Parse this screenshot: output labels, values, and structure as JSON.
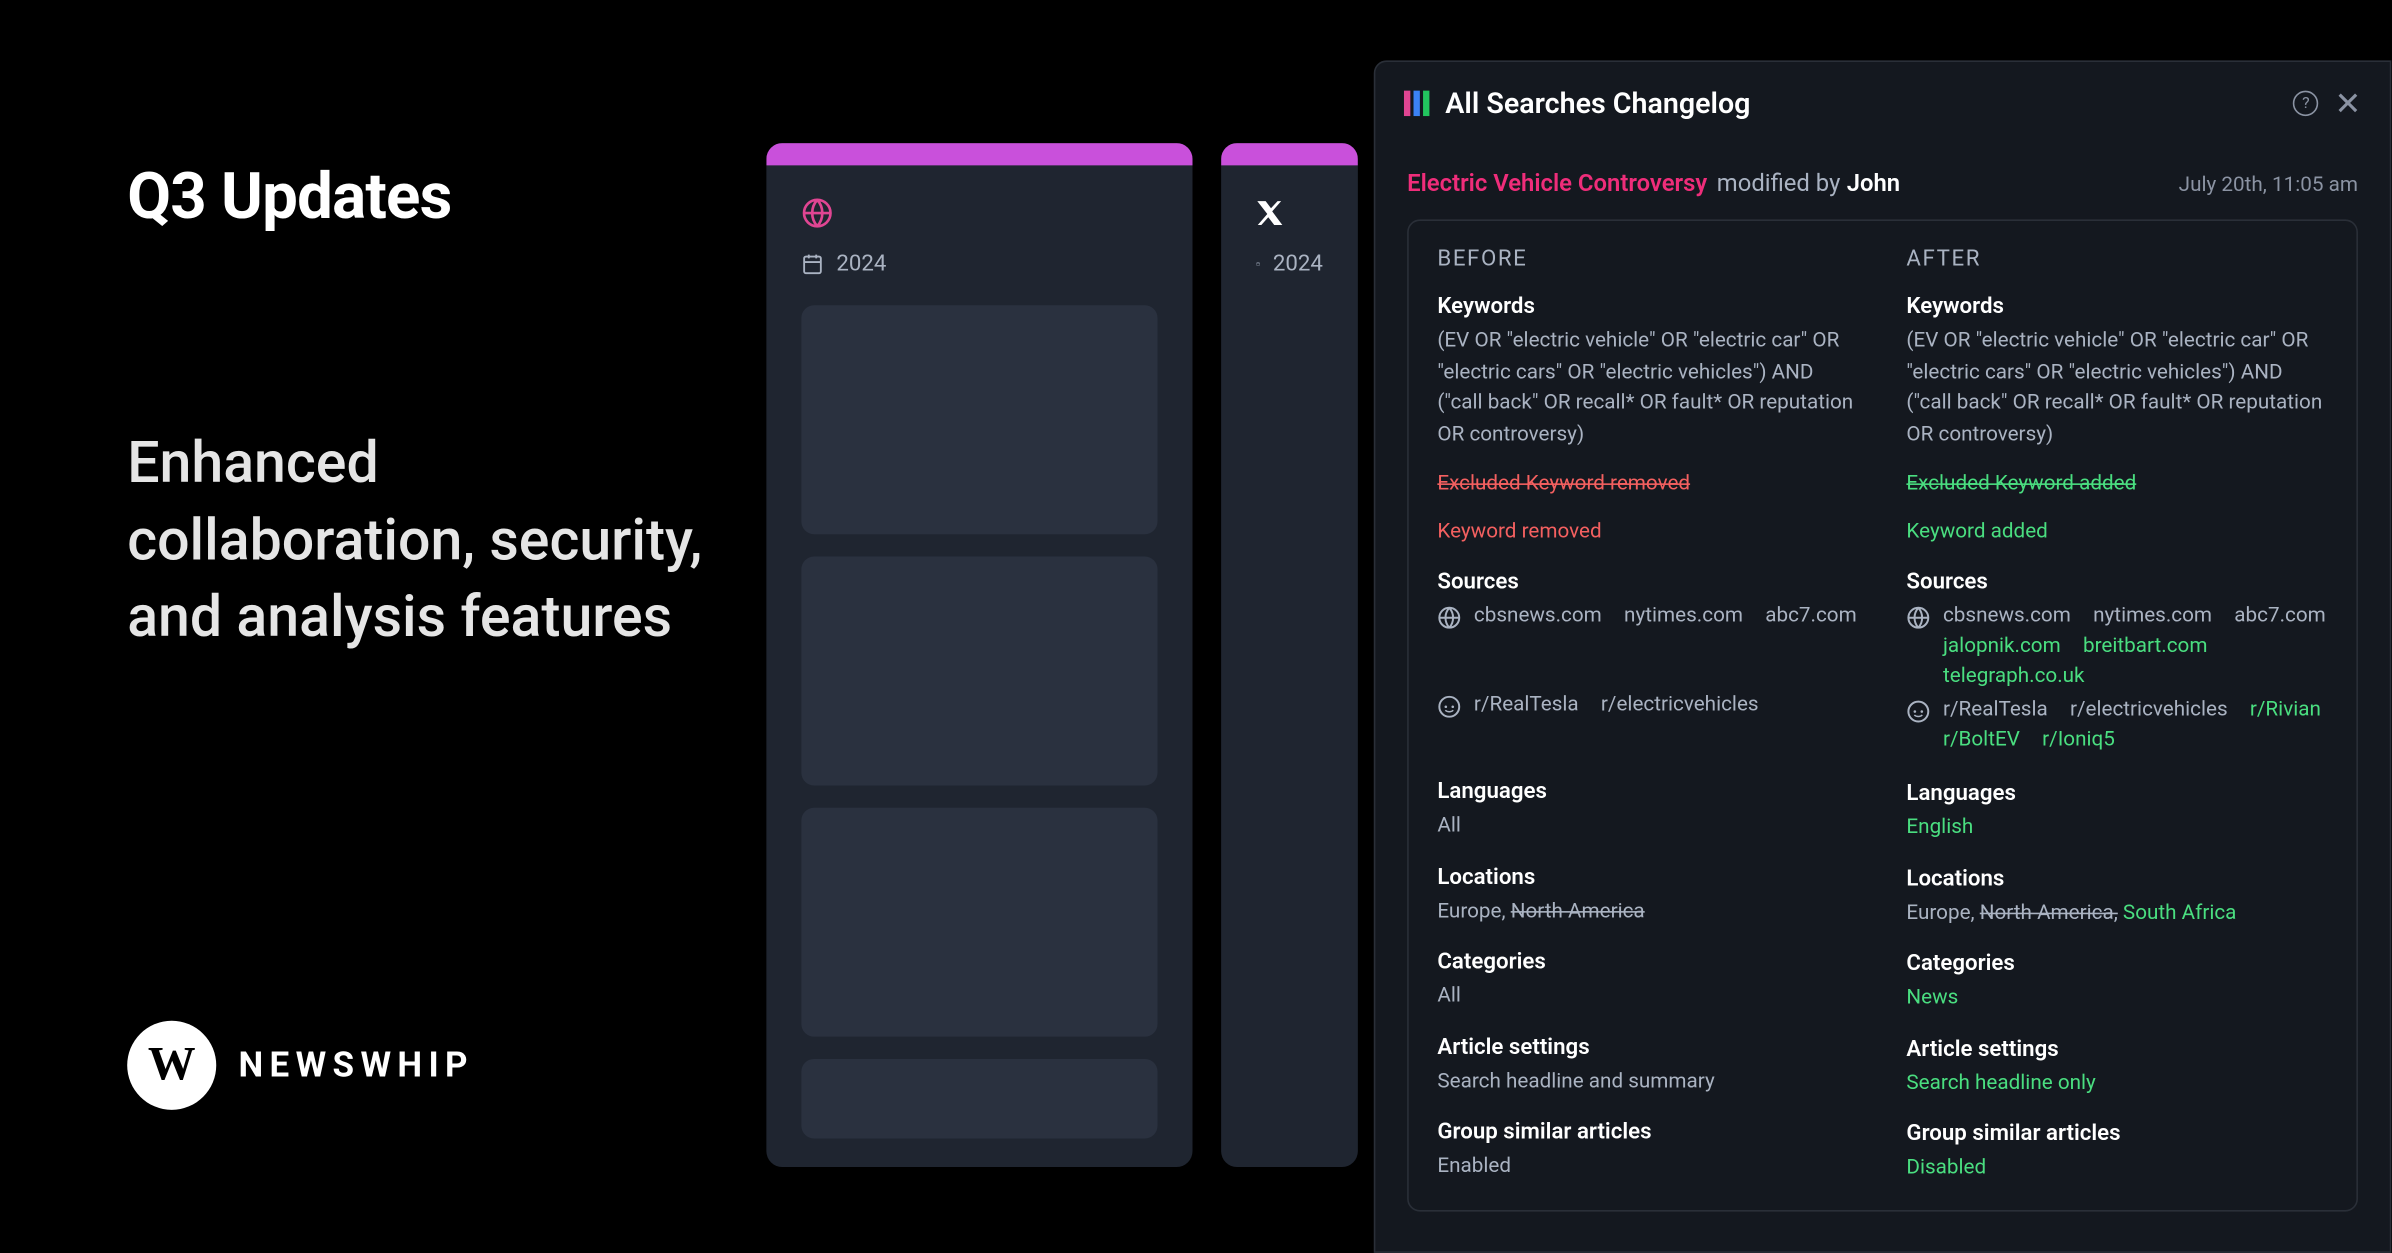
{
  "hero": {
    "title": "Q3 Updates",
    "subtitle": "Enhanced collaboration, security, and analysis features"
  },
  "logo": {
    "letter": "W",
    "text": "NEWSWHIP"
  },
  "cards": {
    "year": "2024"
  },
  "panel": {
    "title": "All Searches Changelog",
    "entry_name": "Electric Vehicle Controversy",
    "modified_by": "modified by",
    "user": "John",
    "date": "July 20th, 11:05 am",
    "before_label": "BEFORE",
    "after_label": "AFTER",
    "sections": {
      "keywords": "Keywords",
      "sources": "Sources",
      "languages": "Languages",
      "locations": "Locations",
      "categories": "Categories",
      "article_settings": "Article settings",
      "group_similar": "Group similar articles"
    },
    "before": {
      "keywords_query": "(EV OR \"electric vehicle\" OR \"electric car\" OR \"electric cars\" OR \"electric vehicles\") AND (\"call back\" OR recall* OR fault* OR reputation OR controversy)",
      "excluded_removed": "Excluded Keyword removed",
      "keyword_removed": "Keyword removed",
      "web_sources": [
        "cbsnews.com",
        "nytimes.com",
        "abc7.com"
      ],
      "reddit_sources": [
        "r/RealTesla",
        "r/electricvehicles"
      ],
      "languages": "All",
      "locations_keep": "Europe, ",
      "locations_strike": "North America",
      "categories": "All",
      "article_settings": "Search headline and summary",
      "group_similar": "Enabled"
    },
    "after": {
      "keywords_query": "(EV OR \"electric vehicle\" OR \"electric car\" OR \"electric cars\" OR \"electric vehicles\") AND (\"call back\" OR recall* OR fault* OR reputation OR controversy)",
      "excluded_added": "Excluded Keyword added",
      "keyword_added": "Keyword added",
      "web_sources": [
        "cbsnews.com",
        "nytimes.com",
        "abc7.com"
      ],
      "web_sources_added": [
        "jalopnik.com",
        "breitbart.com",
        "telegraph.co.uk"
      ],
      "reddit_sources": [
        "r/RealTesla",
        "r/electricvehicles"
      ],
      "reddit_sources_added": [
        "r/Rivian",
        "r/BoltEV",
        "r/Ioniq5"
      ],
      "languages": "English",
      "locations_keep": "Europe, ",
      "locations_strike": "North America,",
      "locations_added": " South Africa",
      "categories": "News",
      "article_settings": "Search headline only",
      "group_similar": "Disabled"
    }
  }
}
